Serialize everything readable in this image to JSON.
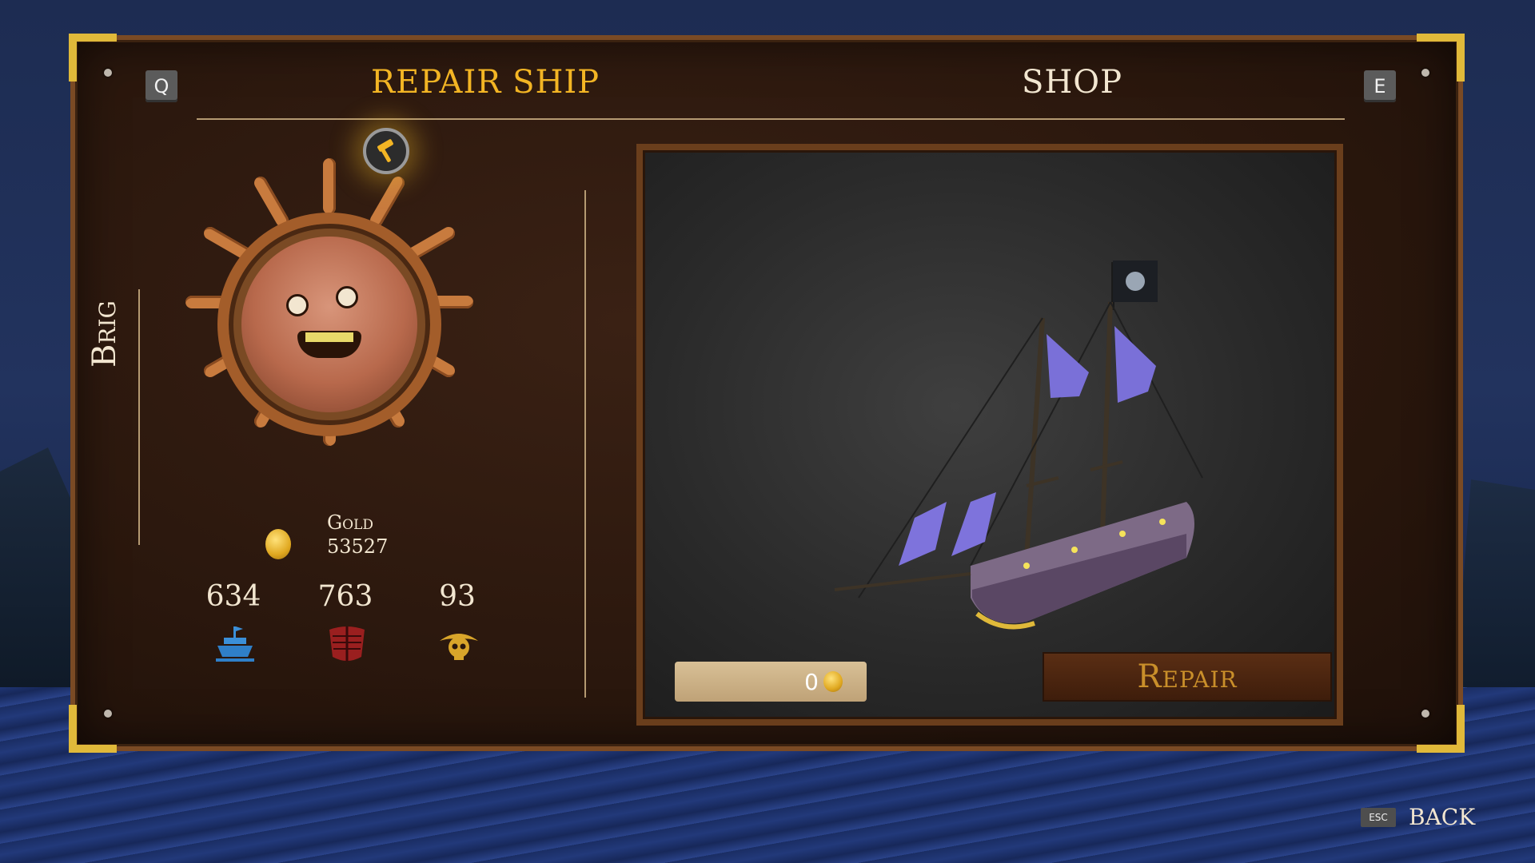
{
  "header": {
    "prev_key": "Q",
    "next_key": "E",
    "tabs": [
      {
        "label": "REPAIR SHIP",
        "active": true
      },
      {
        "label": "SHOP",
        "active": false
      }
    ]
  },
  "ship": {
    "class_label": "Brig"
  },
  "gold": {
    "label": "Gold",
    "value": "53527"
  },
  "stats": [
    {
      "value": "634",
      "icon": "ship-hull-icon"
    },
    {
      "value": "763",
      "icon": "armor-plates-icon"
    },
    {
      "value": "93",
      "icon": "pirate-skull-icon"
    }
  ],
  "repair": {
    "cost": "0",
    "button_label": "Repair"
  },
  "footer": {
    "esc_key": "ESC",
    "back_label": "BACK"
  },
  "colors": {
    "accent_gold": "#f3b524",
    "text_cream": "#f2e6d0",
    "frame_wood": "#7a4a24",
    "corner_gold": "#e0b93a"
  }
}
